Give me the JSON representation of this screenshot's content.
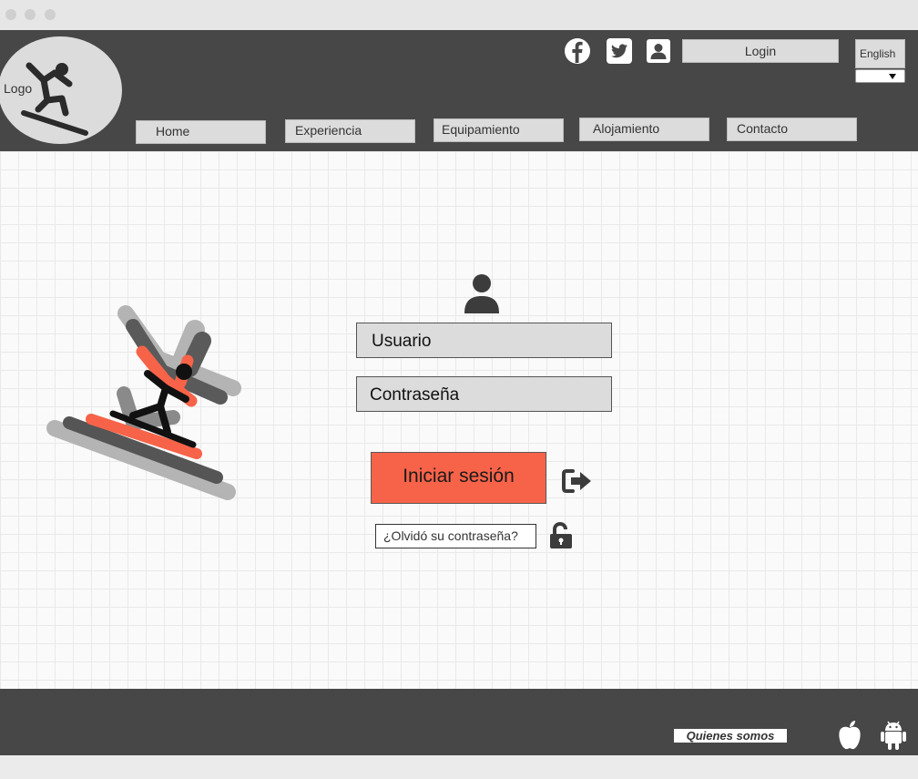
{
  "header": {
    "logo_label": "Logo",
    "login_label": "Login",
    "language": "English",
    "social_icons": [
      "facebook-icon",
      "twitter-icon",
      "user-profile-icon"
    ]
  },
  "nav": {
    "items": [
      {
        "label": "Home"
      },
      {
        "label": "Experiencia"
      },
      {
        "label": "Equipamiento"
      },
      {
        "label": "Alojamiento"
      },
      {
        "label": "Contacto"
      }
    ]
  },
  "login_form": {
    "username_placeholder": "Usuario",
    "password_placeholder": "Contraseña",
    "submit_label": "Iniciar sesión",
    "forgot_label": "¿Olvidó su contraseña?"
  },
  "footer": {
    "about_label": "Quienes somos",
    "store_icons": [
      "apple-icon",
      "android-icon"
    ]
  },
  "colors": {
    "header_bg": "#474747",
    "accent": "#f76349",
    "control_bg": "#dcdcdc"
  }
}
